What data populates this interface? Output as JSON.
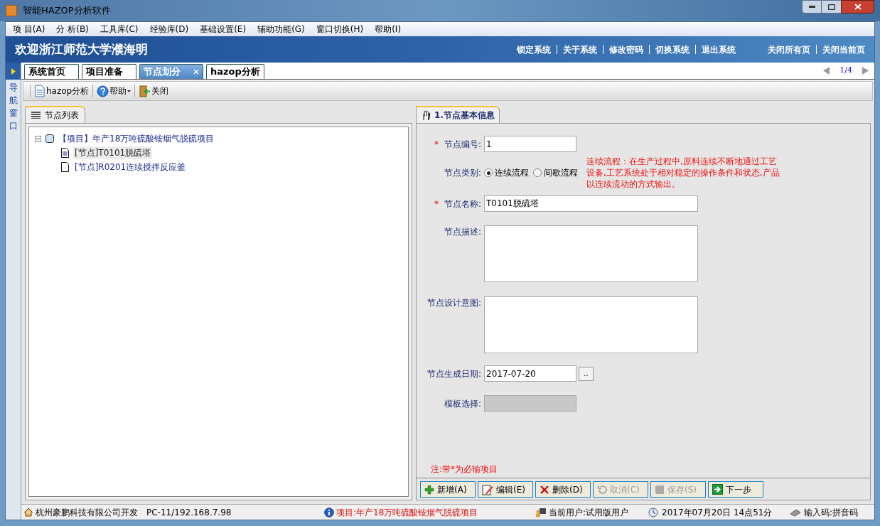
{
  "window": {
    "title": "智能HAZOP分析软件"
  },
  "menu": [
    "项 目(A)",
    "分 析(B)",
    "工具库(C)",
    "经验库(D)",
    "基础设置(E)",
    "辅助功能(G)",
    "窗口切换(H)",
    "帮助(I)"
  ],
  "banner": {
    "welcome": "欢迎浙江师范大学濮海明",
    "links": [
      "锁定系统",
      "关于系统",
      "修改密码",
      "切换系统",
      "退出系统"
    ],
    "page_links": [
      "关闭所有页",
      "关闭当前页"
    ]
  },
  "nav": {
    "label": "导航窗口"
  },
  "tabs": [
    {
      "label": "系统首页",
      "selected": false,
      "closable": false
    },
    {
      "label": "项目准备",
      "selected": false,
      "closable": false
    },
    {
      "label": "节点划分",
      "selected": true,
      "closable": true
    },
    {
      "label": "hazop分析",
      "selected": false,
      "closable": false
    }
  ],
  "pager": "1/4",
  "toolbar": [
    {
      "label": "hazop分析",
      "kind": "document"
    },
    {
      "label": "帮助",
      "kind": "help"
    },
    {
      "label": "关闭",
      "kind": "exit"
    }
  ],
  "node_list": {
    "tab": "节点列表",
    "tree": [
      {
        "label": "【项目】年产18万吨硫酸铵烟气脱硫项目",
        "expanded": true,
        "children": [
          {
            "label": "[节点]T0101脱硫塔",
            "selected": true
          },
          {
            "label": "[节点]R0201连续搅拌反应釜",
            "selected": false
          }
        ]
      }
    ]
  },
  "form": {
    "tab": "1.节点基本信息",
    "fields": [
      {
        "kind": "text",
        "label": "节点编号:",
        "required_mark": "*",
        "value": "1",
        "wide": false
      },
      {
        "kind": "radio",
        "label": "节点类别:",
        "options": [
          {
            "label": "连续流程",
            "selected": true
          },
          {
            "label": "间歇流程",
            "selected": false
          }
        ],
        "hint": "连续流程：在生产过程中,原料连续不断地通过工艺设备,工艺系统处于相对稳定的操作条件和状态,产品以连续流动的方式输出。"
      },
      {
        "kind": "text",
        "label": "节点名称:",
        "required_mark": "*",
        "value": "T0101脱硫塔",
        "wide": true
      },
      {
        "kind": "textarea",
        "label": "节点描述:"
      },
      {
        "kind": "textarea",
        "label": "节点设计意图:"
      },
      {
        "kind": "date",
        "label": "节点生成日期:",
        "value": "2017-07-20",
        "button": ".."
      },
      {
        "kind": "select",
        "label": "模板选择:",
        "disabled": true
      }
    ],
    "note": "注:带*为必输项目",
    "buttons": [
      {
        "label": "新增(A)",
        "kind": "add",
        "disabled": false
      },
      {
        "label": "编辑(E)",
        "kind": "edit",
        "disabled": false
      },
      {
        "label": "删除(D)",
        "kind": "delete",
        "disabled": false
      },
      {
        "label": "取消(C)",
        "kind": "cancel",
        "disabled": true
      },
      {
        "label": "保存(S)",
        "kind": "save",
        "disabled": true
      },
      {
        "label": "下一步",
        "kind": "next",
        "disabled": false
      }
    ]
  },
  "status_bar": {
    "company": "杭州豪鹏科技有限公司开发",
    "host": "PC-11/192.168.7.98",
    "project": "项目:年产18万吨硫酸铵烟气脱硫项目",
    "user": "当前用户:试用版用户",
    "datetime": "2017年07月20日 14点51分",
    "input": "输入码:拼音码"
  }
}
